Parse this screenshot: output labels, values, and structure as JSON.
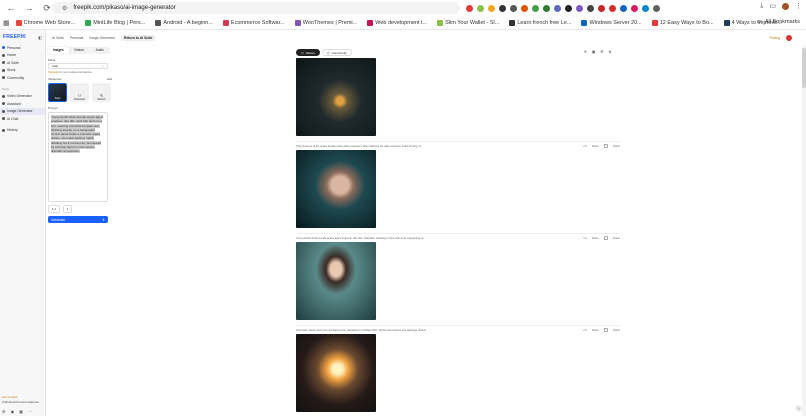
{
  "browser": {
    "url": "freepik.com/pikaso/ai-image-generator",
    "bookmarks": [
      {
        "label": "Chrome Web Store...",
        "color": "#e8453c"
      },
      {
        "label": "MintLife Blog | Pers...",
        "color": "#2fa84f"
      },
      {
        "label": "Android - A beginn...",
        "color": "#555555"
      },
      {
        "label": "Ecommerce Softwar...",
        "color": "#d33b55"
      },
      {
        "label": "WooThemes | Premi...",
        "color": "#7f54b3"
      },
      {
        "label": "Web development t...",
        "color": "#c2185b"
      },
      {
        "label": "Slim Your Wallet - Sl...",
        "color": "#8bc34a"
      },
      {
        "label": "Learn french free Le...",
        "color": "#333333"
      },
      {
        "label": "Windows Server 20...",
        "color": "#0a66c2"
      },
      {
        "label": "12 Easy Ways to Bo...",
        "color": "#e53935"
      },
      {
        "label": "4 Ways to Improve...",
        "color": "#1e3a5f"
      }
    ],
    "all_bookmarks": "All Bookmarks"
  },
  "sidebar": {
    "logo": "FREEPIK",
    "workspace": "Personal",
    "items": [
      "Home",
      "AI Suite",
      "Stock",
      "Community"
    ],
    "section": "Tools",
    "tools": [
      "Video Generator",
      "Assistant",
      "Image Generator",
      "AI Chat"
    ],
    "history": "History",
    "bottom_title": "Get Limited",
    "bottom_sub": "Unlimited Premium features"
  },
  "topbar": {
    "crumbs": [
      "AI Suite",
      "Personal",
      "Image Generator"
    ],
    "active_crumb": "Return to AI Suite",
    "pricing": "Pricing"
  },
  "panel": {
    "tabs": [
      "Images",
      "Videos",
      "Audio"
    ],
    "mode_label": "Mode",
    "mode_value": "Auto",
    "hint_link": "Upgrade",
    "hint_text": " for more modes and features",
    "influences_label": "Influences",
    "influences_action": "Add",
    "styles": [
      "Style",
      "Character",
      "Sketch"
    ],
    "prompt_label": "Prompt",
    "prompt_text": "Young South Asian female space agent engineer, late 30s, dark hair tied into a bun, wearing a functional space suit. Working intently on a holographic control panel inside a futuristic space station, cinematic lighting, highly detailed, sci-fi concept art, illuminated by soft blue light from the screen, dramatic atmosphere.",
    "btn_size": "1:1",
    "btn_count": "1",
    "generate": "Generate"
  },
  "content": {
    "tabs": [
      "History",
      "Community"
    ],
    "items": [
      {
        "caption": "",
        "meta": ""
      },
      {
        "caption": "Tight close-up of the space female-stock water-engineer's face reflecting the data computer. Tears forming, fo...",
        "meta": "1:1"
      },
      {
        "caption": "Young South Asian female space agent engineer, late 30s, hold data, standing in front look at AI engineering sp...",
        "meta": "1:1"
      },
      {
        "caption": "Cinematic interior shot from the data tunnel, dispelling it in brilliant light. Vibrant atmosphere and paintings. Bloom...",
        "meta": "1:1"
      }
    ],
    "item_action": "Share",
    "item_select": "Select"
  }
}
